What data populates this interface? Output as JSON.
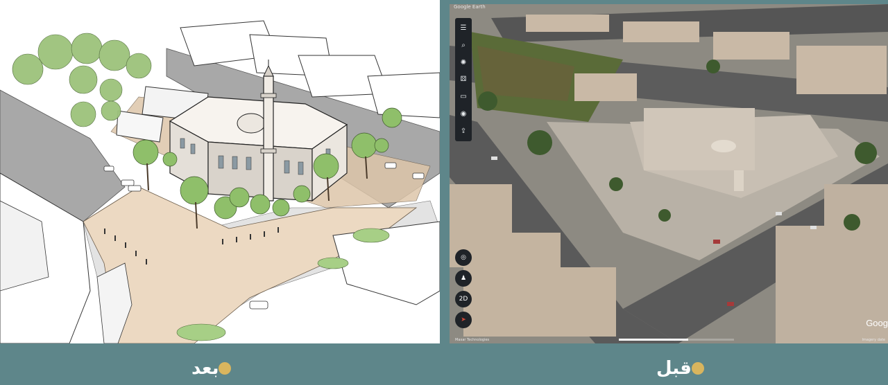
{
  "captions": {
    "after_label": "بعد",
    "before_label": "قبل",
    "bullet_color": "#d9b55e"
  },
  "colors": {
    "background": "#5e868a",
    "sketch_paving": "#ecd9c2",
    "road": "#a3a3a3",
    "greenery": "#9cc27b"
  },
  "earth_viewer": {
    "top_attribution": "Google Earth",
    "bottom_left_attribution": "Maxar Technologies",
    "bottom_right_attribution": "Imagery date",
    "logo": "Goog",
    "two_d_label": "2D",
    "toolbar_icons": [
      "menu-icon",
      "search-icon",
      "voyager-icon",
      "dice-icon",
      "measure-icon",
      "camera-icon",
      "share-icon"
    ],
    "toolbar_glyphs": [
      "☰",
      "⌕",
      "✺",
      "⚄",
      "▭",
      "◉",
      "⇪"
    ],
    "locate_glyph": "◎",
    "pegman_glyph": "♟",
    "compass_glyph": "➤",
    "progress": 0.6
  }
}
